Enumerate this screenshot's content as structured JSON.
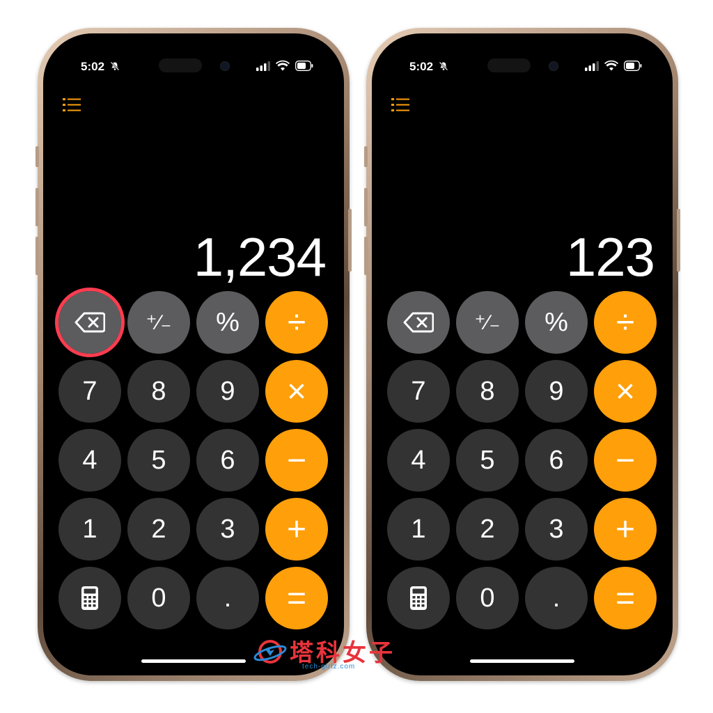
{
  "status": {
    "time": "5:02"
  },
  "phones": [
    {
      "display": "1,234"
    },
    {
      "display": "123"
    }
  ],
  "keys": {
    "plus_minus": "⁺∕₋",
    "percent": "%",
    "divide": "÷",
    "multiply": "×",
    "minus": "−",
    "plus": "+",
    "equals": "=",
    "decimal": ".",
    "d7": "7",
    "d8": "8",
    "d9": "9",
    "d4": "4",
    "d5": "5",
    "d6": "6",
    "d1": "1",
    "d2": "2",
    "d3": "3",
    "d0": "0"
  },
  "icons": {
    "menu": "list-icon",
    "backspace": "backspace-icon",
    "calculator": "calculator-icon",
    "bell": "bell-slash-icon",
    "signal": "signal-icon",
    "wifi": "wifi-icon",
    "battery": "battery-icon"
  },
  "colors": {
    "operator": "#ff9f0a",
    "digit": "#333333",
    "function": "#5c5c5e",
    "highlight": "#ff3c50"
  },
  "highlighted_key": "backspace",
  "watermark": {
    "text": "塔科女子",
    "sub": "tech-girlz.com"
  }
}
